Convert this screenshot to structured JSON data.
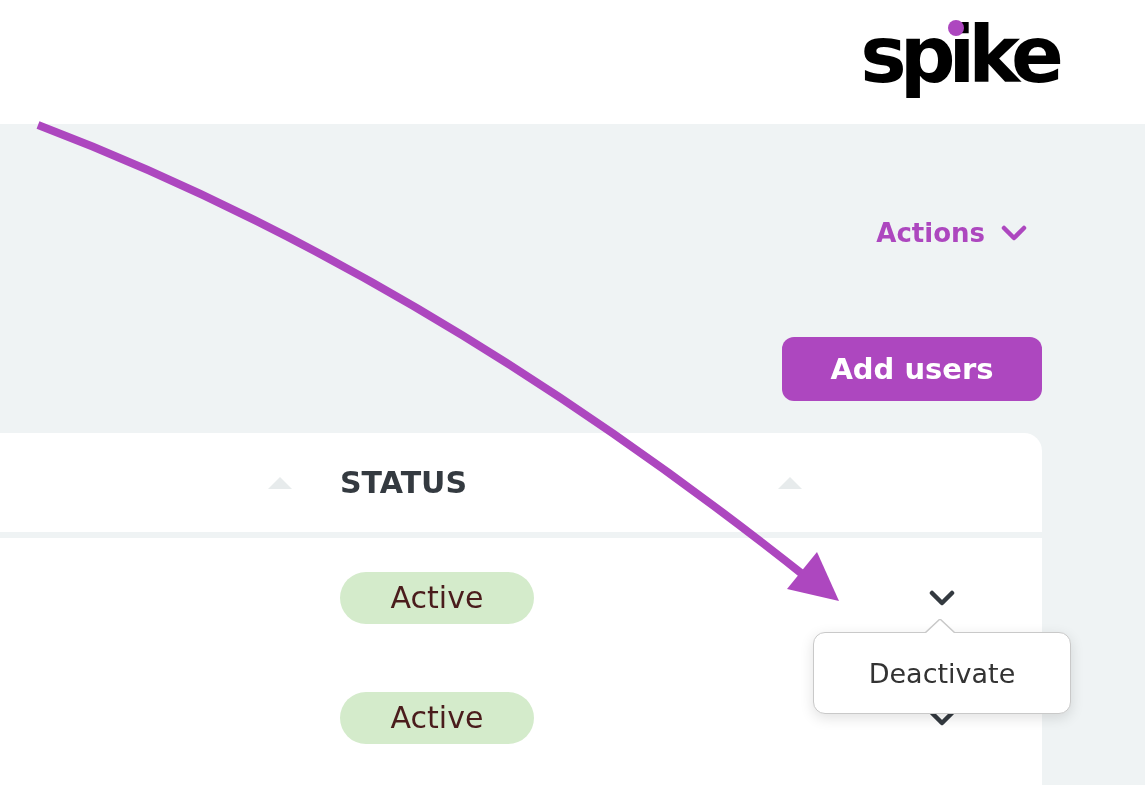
{
  "header": {
    "logo": "spike"
  },
  "toolbar": {
    "actions_menu": {
      "label": "Actions",
      "expanded": false
    },
    "add_button": {
      "label": "Add users"
    }
  },
  "table": {
    "columns": [
      {
        "label": "STATUS"
      }
    ],
    "rows": [
      {
        "status": "Active",
        "menu_open": true
      },
      {
        "status": "Active",
        "menu_open": false
      }
    ]
  },
  "row_menu": {
    "items": [
      {
        "label": "Deactivate"
      }
    ]
  }
}
